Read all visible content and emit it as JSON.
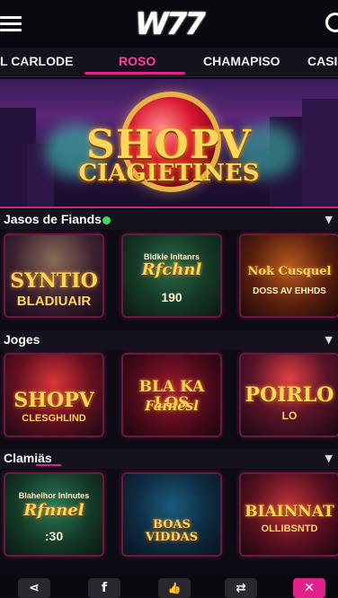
{
  "header": {
    "logo": "W77"
  },
  "tabs": [
    {
      "label": "L CARLODE",
      "active": false
    },
    {
      "label": "ROSO",
      "active": true
    },
    {
      "label": "CHAMAPISO",
      "active": false
    },
    {
      "label": "CASI",
      "active": false
    }
  ],
  "banner": {
    "title_line1": "SHOPV",
    "title_line2": "CIAGIETINES"
  },
  "sections": [
    {
      "title": "Jasos de Fiands",
      "live_dot": true,
      "cards": [
        {
          "title": "SYNTIO",
          "subtitle": "BLADIUAIR"
        },
        {
          "title": "Rfchnl",
          "subtitle": "190",
          "caption": "Bldkle Inltanrs"
        },
        {
          "title": "Nok Cusquel",
          "subtitle": "DOSS AV EHHDS"
        }
      ]
    },
    {
      "title": "Joges",
      "live_dot": false,
      "cards": [
        {
          "title": "SHOPV",
          "subtitle": "CLESGHLIND"
        },
        {
          "title": "BLA KA LOS",
          "subtitle": "Fainesl"
        },
        {
          "title": "POIRLO",
          "subtitle": "LO"
        }
      ]
    },
    {
      "title": "Clamiäs",
      "live_dot": false,
      "cards": [
        {
          "title": "Rfnnel",
          "subtitle": ":30",
          "caption": "Blaheihor Inlnutes"
        },
        {
          "title": "BOAS VIDDAS",
          "subtitle": ""
        },
        {
          "title": "BIAINNAT",
          "subtitle": "OLLIBSNTD"
        }
      ]
    }
  ],
  "colors": {
    "accent": "#e2218c",
    "gold": "#ffd65a",
    "live": "#3ddc5a",
    "bg": "#0d0b14"
  },
  "bottom_nav": [
    {
      "icon": "share-icon",
      "glyph": "⋖",
      "active": false
    },
    {
      "icon": "facebook-icon",
      "glyph": "f",
      "active": false
    },
    {
      "icon": "thumbs-up-icon",
      "glyph": "👍",
      "active": false
    },
    {
      "icon": "refresh-icon",
      "glyph": "⇄",
      "active": false
    },
    {
      "icon": "gift-icon",
      "glyph": "✕",
      "active": true
    }
  ]
}
